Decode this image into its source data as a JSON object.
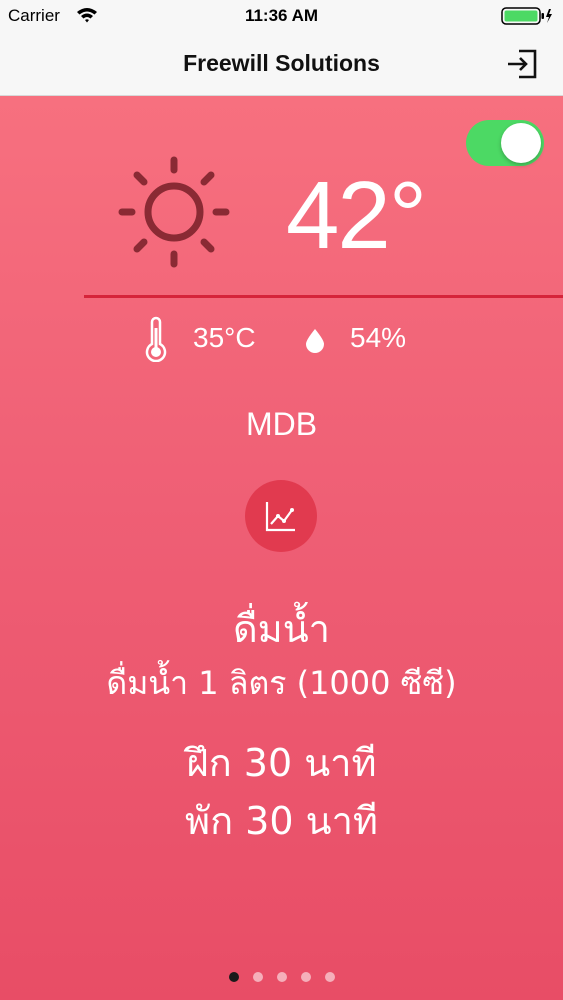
{
  "status_bar": {
    "carrier": "Carrier",
    "time": "11:36 AM",
    "battery_color": "#4cd964"
  },
  "nav": {
    "title": "Freewill Solutions",
    "logout_icon": "logout-icon"
  },
  "weather": {
    "toggle_on": true,
    "toggle_color": "#4cd964",
    "icon": "sun-icon",
    "heat_index": "42°",
    "temperature": "35°C",
    "humidity": "54%",
    "location": "MDB",
    "divider_color": "#d6243a"
  },
  "advice": {
    "drink_title": "ดื่มน้ำ",
    "drink_detail": "ดื่มน้ำ 1 ลิตร (1000 ซีซี)",
    "train": "ฝึก 30 นาที",
    "rest": "พัก 30 นาที"
  },
  "pagination": {
    "total": 5,
    "current": 1
  },
  "colors": {
    "background_top": "#f7707f",
    "background_bottom": "#e84d66",
    "chart_button": "#e13a4f"
  }
}
